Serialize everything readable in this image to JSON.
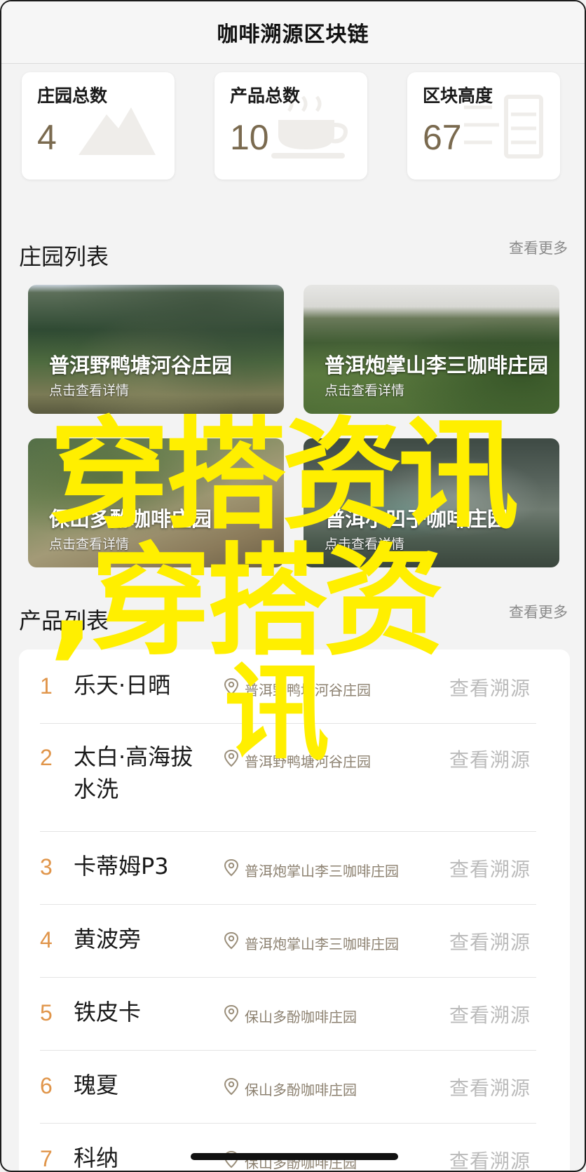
{
  "header": {
    "title": "咖啡溯源区块链"
  },
  "stats": [
    {
      "label": "庄园总数",
      "value": "4",
      "icon": "mountain-icon"
    },
    {
      "label": "产品总数",
      "value": "10",
      "icon": "coffee-cup-icon"
    },
    {
      "label": "区块高度",
      "value": "67",
      "icon": "server-chain-icon"
    }
  ],
  "estates_section": {
    "title": "庄园列表",
    "more": "查看更多"
  },
  "estates": [
    {
      "name": "普洱野鸭塘河谷庄园",
      "hint": "点击查看详情"
    },
    {
      "name": "普洱炮掌山李三咖啡庄园",
      "hint": "点击查看详情"
    },
    {
      "name": "保山多酚咖啡庄园",
      "hint": "点击查看详情"
    },
    {
      "name": "普洱小凹子咖啡庄园",
      "hint": "点击查看详情"
    }
  ],
  "products_section": {
    "title": "产品列表",
    "more": "查看更多"
  },
  "products": [
    {
      "index": "1",
      "name": "乐天·日晒",
      "estate": "普洱野鸭塘河谷庄园",
      "action": "查看溯源"
    },
    {
      "index": "2",
      "name": "太白·高海拔水洗",
      "estate": "普洱野鸭塘河谷庄园",
      "action": "查看溯源"
    },
    {
      "index": "3",
      "name": "卡蒂姆P3",
      "estate": "普洱炮掌山李三咖啡庄园",
      "action": "查看溯源"
    },
    {
      "index": "4",
      "name": "黄波旁",
      "estate": "普洱炮掌山李三咖啡庄园",
      "action": "查看溯源"
    },
    {
      "index": "5",
      "name": "铁皮卡",
      "estate": "保山多酚咖啡庄园",
      "action": "查看溯源"
    },
    {
      "index": "6",
      "name": "瑰夏",
      "estate": "保山多酚咖啡庄园",
      "action": "查看溯源"
    },
    {
      "index": "7",
      "name": "科纳",
      "estate": "保山多酚咖啡庄园",
      "action": "查看溯源"
    }
  ],
  "watermark": {
    "line1": "穿搭资讯",
    "line2": ",穿搭资",
    "line3": "讯"
  },
  "colors": {
    "accent_index": "#e0954a",
    "stat_value": "#7a6a4f",
    "watermark": "#ffef00"
  }
}
